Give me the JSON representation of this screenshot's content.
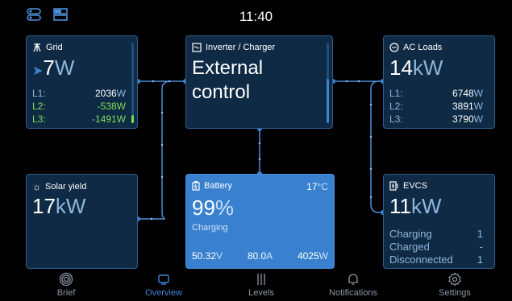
{
  "header": {
    "time": "11:40"
  },
  "grid": {
    "title": "Grid",
    "value": "7",
    "unit": "W",
    "rows": [
      {
        "label": "L1:",
        "value": "2036",
        "unit": "W"
      },
      {
        "label": "L2:",
        "value": "-538",
        "unit": "W"
      },
      {
        "label": "L3:",
        "value": "-1491",
        "unit": "W"
      }
    ]
  },
  "inverter": {
    "title": "Inverter / Charger",
    "line1": "External",
    "line2": "control"
  },
  "ac_loads": {
    "title": "AC Loads",
    "value": "14",
    "unit": "kW",
    "rows": [
      {
        "label": "L1:",
        "value": "6748",
        "unit": "W"
      },
      {
        "label": "L2:",
        "value": "3891",
        "unit": "W"
      },
      {
        "label": "L3:",
        "value": "3790",
        "unit": "W"
      }
    ]
  },
  "solar": {
    "title": "Solar yield",
    "value": "17",
    "unit": "kW"
  },
  "battery": {
    "title": "Battery",
    "temp": "17",
    "temp_unit": "°C",
    "soc": "99",
    "soc_unit": "%",
    "state": "Charging",
    "voltage": "50.32",
    "voltage_unit": "V",
    "current": "80.0",
    "current_unit": "A",
    "power": "4025",
    "power_unit": "W"
  },
  "evcs": {
    "title": "EVCS",
    "value": "11",
    "unit": "kW",
    "rows": [
      {
        "label": "Charging",
        "value": "1"
      },
      {
        "label": "Charged",
        "value": "-"
      },
      {
        "label": "Disconnected",
        "value": "1"
      }
    ]
  },
  "nav": {
    "items": [
      {
        "label": "Brief"
      },
      {
        "label": "Overview"
      },
      {
        "label": "Levels"
      },
      {
        "label": "Notifications"
      },
      {
        "label": "Settings"
      }
    ]
  },
  "colors": {
    "accent": "#3b84d6",
    "card": "#0f2a44",
    "border": "#2f5f8c",
    "battery": "#3981cf",
    "positive": "#7cdc58"
  }
}
